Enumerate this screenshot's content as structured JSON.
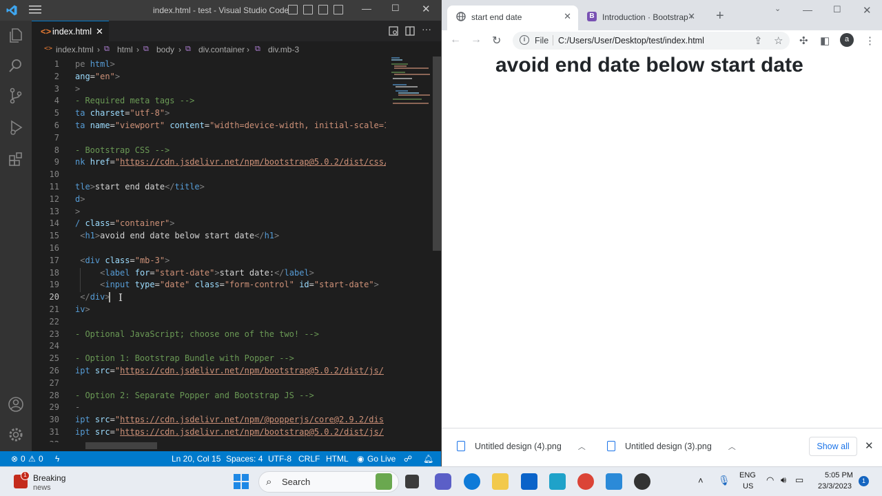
{
  "vscode": {
    "title": "index.html - test - Visual Studio Code",
    "tab_label": "index.html",
    "breadcrumb": [
      "index.html",
      "html",
      "body",
      "div.container",
      "div.mb-3"
    ],
    "code_lines": [
      {
        "n": "1",
        "segs": [
          [
            "t",
            "pe "
          ],
          [
            "k",
            "html"
          ],
          [
            "t",
            ">"
          ]
        ]
      },
      {
        "n": "2",
        "segs": [
          [
            "a",
            "ang"
          ],
          [
            "w",
            "="
          ],
          [
            "s",
            "\"en\""
          ],
          [
            "t",
            ">"
          ]
        ]
      },
      {
        "n": "3",
        "segs": [
          [
            "t",
            ">"
          ]
        ]
      },
      {
        "n": "4",
        "segs": [
          [
            "c",
            "- Required meta tags -->"
          ]
        ]
      },
      {
        "n": "5",
        "segs": [
          [
            "k",
            "ta "
          ],
          [
            "a",
            "charset"
          ],
          [
            "w",
            "="
          ],
          [
            "s",
            "\"utf-8\""
          ],
          [
            "t",
            ">"
          ]
        ]
      },
      {
        "n": "6",
        "segs": [
          [
            "k",
            "ta "
          ],
          [
            "a",
            "name"
          ],
          [
            "w",
            "="
          ],
          [
            "s",
            "\"viewport\""
          ],
          [
            "w",
            " "
          ],
          [
            "a",
            "content"
          ],
          [
            "w",
            "="
          ],
          [
            "s",
            "\"width=device-width, initial-scale=1"
          ]
        ]
      },
      {
        "n": "7",
        "segs": []
      },
      {
        "n": "8",
        "segs": [
          [
            "c",
            "- Bootstrap CSS -->"
          ]
        ]
      },
      {
        "n": "9",
        "segs": [
          [
            "k",
            "nk "
          ],
          [
            "a",
            "href"
          ],
          [
            "w",
            "="
          ],
          [
            "s",
            "\""
          ],
          [
            "u",
            "https://cdn.jsdelivr.net/npm/bootstrap@5.0.2/dist/css/"
          ]
        ]
      },
      {
        "n": "10",
        "segs": []
      },
      {
        "n": "11",
        "segs": [
          [
            "k",
            "tle"
          ],
          [
            "t",
            ">"
          ],
          [
            "w",
            "start end date"
          ],
          [
            "t",
            "</"
          ],
          [
            "k",
            "title"
          ],
          [
            "t",
            ">"
          ]
        ]
      },
      {
        "n": "12",
        "segs": [
          [
            "k",
            "d"
          ],
          [
            "t",
            ">"
          ]
        ]
      },
      {
        "n": "13",
        "segs": [
          [
            "t",
            ">"
          ]
        ]
      },
      {
        "n": "14",
        "segs": [
          [
            "k",
            "/ "
          ],
          [
            "a",
            "class"
          ],
          [
            "w",
            "="
          ],
          [
            "s",
            "\"container\""
          ],
          [
            "t",
            ">"
          ]
        ]
      },
      {
        "n": "15",
        "segs": [
          [
            "t",
            " <"
          ],
          [
            "k",
            "h1"
          ],
          [
            "t",
            ">"
          ],
          [
            "w",
            "avoid end date below start date"
          ],
          [
            "t",
            "</"
          ],
          [
            "k",
            "h1"
          ],
          [
            "t",
            ">"
          ]
        ]
      },
      {
        "n": "16",
        "segs": []
      },
      {
        "n": "17",
        "segs": [
          [
            "t",
            " <"
          ],
          [
            "k",
            "div "
          ],
          [
            "a",
            "class"
          ],
          [
            "w",
            "="
          ],
          [
            "s",
            "\"mb-3\""
          ],
          [
            "t",
            ">"
          ]
        ]
      },
      {
        "n": "18",
        "segs": [
          [
            "w",
            "     "
          ],
          [
            "t",
            "<"
          ],
          [
            "k",
            "label "
          ],
          [
            "a",
            "for"
          ],
          [
            "w",
            "="
          ],
          [
            "s",
            "\"start-date\""
          ],
          [
            "t",
            ">"
          ],
          [
            "w",
            "start date:"
          ],
          [
            "t",
            "</"
          ],
          [
            "k",
            "label"
          ],
          [
            "t",
            ">"
          ]
        ]
      },
      {
        "n": "19",
        "segs": [
          [
            "w",
            "     "
          ],
          [
            "t",
            "<"
          ],
          [
            "k",
            "input "
          ],
          [
            "a",
            "type"
          ],
          [
            "w",
            "="
          ],
          [
            "s",
            "\"date\""
          ],
          [
            "w",
            " "
          ],
          [
            "a",
            "class"
          ],
          [
            "w",
            "="
          ],
          [
            "s",
            "\"form-control\""
          ],
          [
            "w",
            " "
          ],
          [
            "a",
            "id"
          ],
          [
            "w",
            "="
          ],
          [
            "s",
            "\"start-date\""
          ],
          [
            "t",
            ">"
          ]
        ]
      },
      {
        "n": "20",
        "segs": [
          [
            "t",
            " </"
          ],
          [
            "k",
            "div"
          ],
          [
            "t",
            ">"
          ]
        ]
      },
      {
        "n": "21",
        "segs": [
          [
            "k",
            "iv"
          ],
          [
            "t",
            ">"
          ]
        ]
      },
      {
        "n": "22",
        "segs": []
      },
      {
        "n": "23",
        "segs": [
          [
            "c",
            "- Optional JavaScript; choose one of the two! -->"
          ]
        ]
      },
      {
        "n": "24",
        "segs": []
      },
      {
        "n": "25",
        "segs": [
          [
            "c",
            "- Option 1: Bootstrap Bundle with Popper -->"
          ]
        ]
      },
      {
        "n": "26",
        "segs": [
          [
            "k",
            "ipt "
          ],
          [
            "a",
            "src"
          ],
          [
            "w",
            "="
          ],
          [
            "s",
            "\""
          ],
          [
            "u",
            "https://cdn.jsdelivr.net/npm/bootstrap@5.0.2/dist/js/"
          ]
        ]
      },
      {
        "n": "27",
        "segs": []
      },
      {
        "n": "28",
        "segs": [
          [
            "c",
            "- Option 2: Separate Popper and Bootstrap JS -->"
          ]
        ]
      },
      {
        "n": "29",
        "segs": [
          [
            "t",
            "-"
          ]
        ]
      },
      {
        "n": "30",
        "segs": [
          [
            "k",
            "ipt "
          ],
          [
            "a",
            "src"
          ],
          [
            "w",
            "="
          ],
          [
            "s",
            "\""
          ],
          [
            "u",
            "https://cdn.jsdelivr.net/npm/@popperjs/core@2.9.2/dis"
          ]
        ]
      },
      {
        "n": "31",
        "segs": [
          [
            "k",
            "ipt "
          ],
          [
            "a",
            "src"
          ],
          [
            "w",
            "="
          ],
          [
            "s",
            "\""
          ],
          [
            "u",
            "https://cdn.jsdelivr.net/npm/bootstrap@5.0.2/dist/js/"
          ]
        ]
      },
      {
        "n": "32",
        "segs": []
      }
    ],
    "current_line": "20",
    "status": {
      "problems_errors": "0",
      "problems_warnings": "0",
      "position": "Ln 20, Col 15",
      "spaces": "Spaces: 4",
      "encoding": "UTF-8",
      "eol": "CRLF",
      "language": "HTML",
      "go_live": "Go Live"
    }
  },
  "chrome": {
    "tabs": [
      {
        "label": "start end date",
        "active": true
      },
      {
        "label": "Introduction · Bootstrap v",
        "active": false
      }
    ],
    "omnibox_scheme": "File",
    "url": "C:/Users/User/Desktop/test/index.html",
    "avatar_letter": "a",
    "page": {
      "heading": "avoid end date below start date"
    },
    "downloads": [
      "Untitled design (4).png",
      "Untitled design (3).png"
    ],
    "show_all": "Show all"
  },
  "taskbar": {
    "news_line1": "Breaking",
    "news_line2": "news",
    "news_badge": "1",
    "search_placeholder": "Search",
    "lang1": "ENG",
    "lang2": "US",
    "time": "5:05 PM",
    "date": "23/3/2023",
    "notification_count": "1"
  },
  "colors": {
    "vscode_accent": "#007acc",
    "html_tag": "#569cd6",
    "attr": "#9cdcfe",
    "string": "#ce9178",
    "comment": "#6a9955"
  }
}
